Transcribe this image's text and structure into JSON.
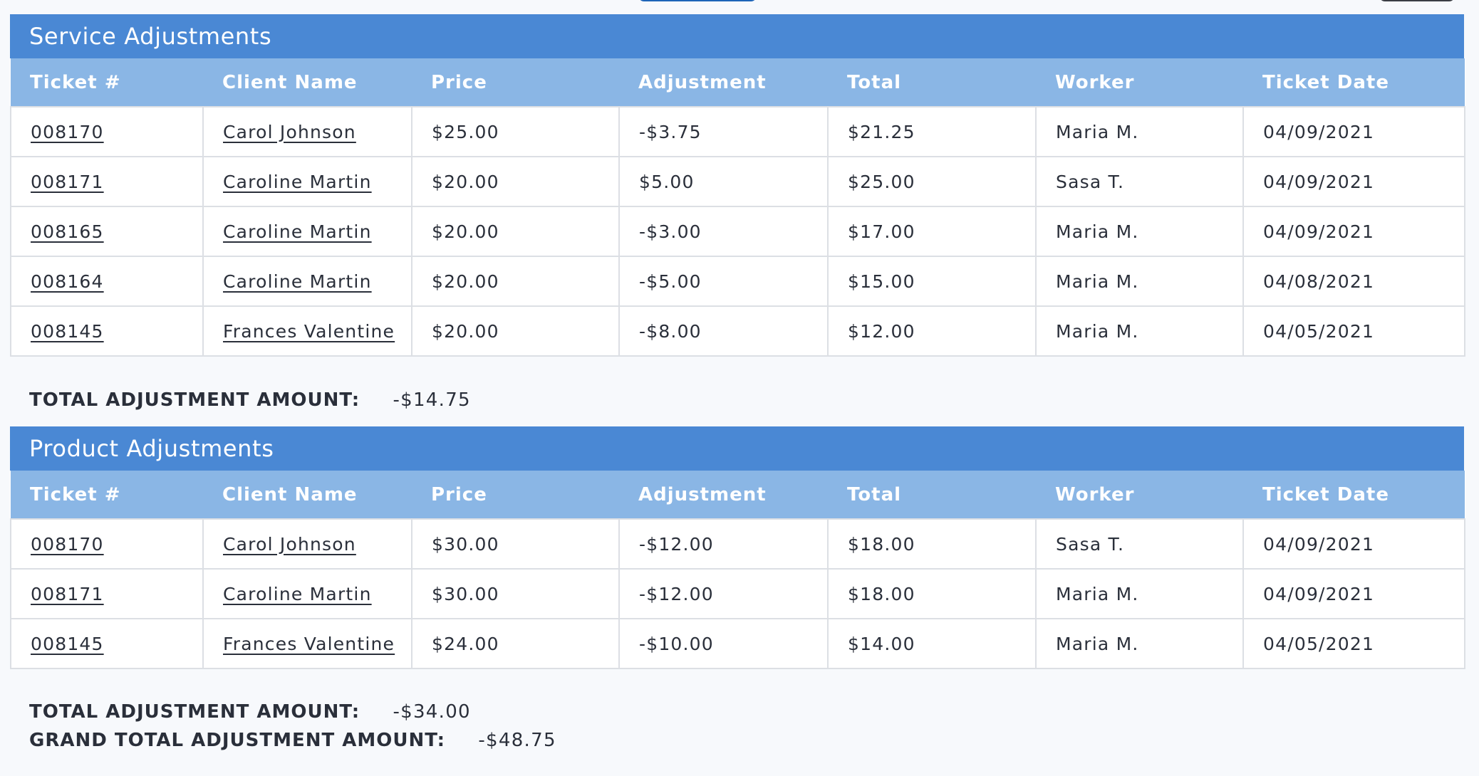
{
  "columns": [
    "Ticket #",
    "Client Name",
    "Price",
    "Adjustment",
    "Total",
    "Worker",
    "Ticket Date"
  ],
  "service": {
    "title": "Service Adjustments",
    "rows": [
      [
        "008170",
        "Carol Johnson",
        "$25.00",
        "-$3.75",
        "$21.25",
        "Maria M.",
        "04/09/2021"
      ],
      [
        "008171",
        "Caroline Martin",
        "$20.00",
        "$5.00",
        "$25.00",
        "Sasa T.",
        "04/09/2021"
      ],
      [
        "008165",
        "Caroline Martin",
        "$20.00",
        "-$3.00",
        "$17.00",
        "Maria M.",
        "04/09/2021"
      ],
      [
        "008164",
        "Caroline Martin",
        "$20.00",
        "-$5.00",
        "$15.00",
        "Maria M.",
        "04/08/2021"
      ],
      [
        "008145",
        "Frances Valentine",
        "$20.00",
        "-$8.00",
        "$12.00",
        "Maria M.",
        "04/05/2021"
      ]
    ],
    "total_label": "TOTAL ADJUSTMENT AMOUNT:",
    "total_value": "-$14.75"
  },
  "product": {
    "title": "Product Adjustments",
    "rows": [
      [
        "008170",
        "Carol Johnson",
        "$30.00",
        "-$12.00",
        "$18.00",
        "Sasa T.",
        "04/09/2021"
      ],
      [
        "008171",
        "Caroline Martin",
        "$30.00",
        "-$12.00",
        "$18.00",
        "Maria M.",
        "04/09/2021"
      ],
      [
        "008145",
        "Frances Valentine",
        "$24.00",
        "-$10.00",
        "$14.00",
        "Maria M.",
        "04/05/2021"
      ]
    ],
    "total_label": "TOTAL ADJUSTMENT AMOUNT:",
    "total_value": "-$34.00"
  },
  "grand_total": {
    "label": "GRAND TOTAL ADJUSTMENT AMOUNT:",
    "value": "-$48.75"
  },
  "colors": {
    "section_header": "#4a88d4",
    "column_header": "#8ab6e5",
    "top_button_blue": "#1d64b8",
    "top_button_dark": "#3a3d44"
  }
}
